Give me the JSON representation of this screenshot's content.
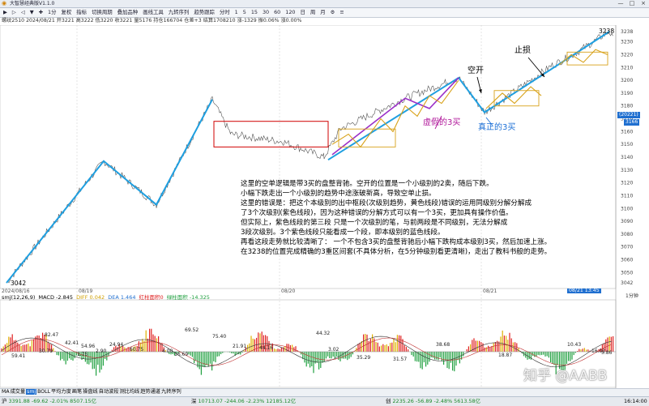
{
  "window": {
    "app_title": "大智慧经典版V1.1.0",
    "minimize": "—",
    "maximize": "□",
    "close": "×"
  },
  "toolbar": {
    "items": [
      "▶",
      "▷",
      "◁",
      "▼",
      "✚",
      "1分",
      "复权",
      "指标",
      "切换周期",
      "叠加品种",
      "画线工具",
      "九转序列",
      "趋势跟踪",
      "分时",
      "1",
      "5",
      "15",
      "30",
      "60",
      "120",
      "日",
      "周",
      "月",
      "⚙",
      "≡"
    ]
  },
  "infobar": {
    "text": "螺纹2510 2024/08/21 开3221 高3222 低3220 收3221 量5176 持仓166704 仓差+3 结算1708210 涨-1329 振0.06% 涨0.00%"
  },
  "price_axis": {
    "labels": [
      "3238",
      "3230",
      "3220",
      "3210",
      "3200",
      "3190",
      "3180",
      "3170",
      "3160",
      "3150",
      "3140",
      "3130",
      "3120",
      "3110",
      "3100",
      "3090",
      "3080",
      "3070",
      "3060",
      "3050",
      "3042"
    ],
    "current_price": "(20221)",
    "current_value": "3166",
    "high_label": "3238",
    "low_label": "3042"
  },
  "date_axis": {
    "labels": [
      "2024/08/16",
      "08/19",
      "08/20",
      "08/21"
    ],
    "time_marker": "08/21 13:45"
  },
  "chart_data": [
    {
      "type": "line",
      "title": "",
      "x": [
        "08/16 09:00",
        "08/16 21:00",
        "08/19 09:00",
        "08/19 21:00",
        "08/20 09:00",
        "08/20 21:00",
        "08/21 09:00",
        "08/21 13:45"
      ],
      "ylim": [
        3042,
        3238
      ],
      "annotations": [
        {
          "text": "空开",
          "color": "#000000"
        },
        {
          "text": "止损",
          "color": "#000000"
        },
        {
          "text": "虚假的3买",
          "color": "#b0179a"
        },
        {
          "text": "真正的3买",
          "color": "#1b6fd6"
        }
      ],
      "colors": {
        "price": "#555555",
        "trend": "#1f9fe0",
        "wrong_segment": "#9b30c8",
        "yellow_segment": "#d8a21a",
        "hub_box": "#d00000"
      }
    },
    {
      "type": "bar",
      "title": "smj(12,26,9)",
      "series": [
        {
          "name": "MACD",
          "values": [
            -2.845
          ]
        },
        {
          "name": "DIFF",
          "values": [
            0.042
          ]
        },
        {
          "name": "DEA",
          "values": [
            1.464
          ]
        }
      ],
      "legend_text": [
        "MACD -2.845",
        "DIFF 0.042",
        "DEA 1.464",
        "红柱面积0",
        "绿柱面积 -14.325"
      ],
      "value_labels": [
        "59.41",
        "82.47",
        "54.96",
        "69.52",
        "75.40",
        "21.91",
        "44.32",
        "38.68",
        "31.57",
        "18.87",
        "16.02",
        "60.75",
        "30.79",
        "42.41",
        "24.94",
        "44.16",
        "5.86",
        "1.75",
        "2.90",
        "4.00",
        "3.02",
        "16.69",
        "35.29",
        "10.43"
      ],
      "colors": {
        "red": "#e02020",
        "green": "#20a040",
        "yellow": "#e0b000"
      }
    }
  ],
  "annotation_text": [
    "这里的空单逻辑是带3买的盘整背驰。空开的位置是一个小级别的2卖，随后下跌。",
    "小幅下跌走出一个小级别的趋势中途涨破新高，导致空单止损。",
    "这里的错误是：把这个本级别的出中枢段(次级别趋势，黄色线段)错误的运用同级别分解分解成",
    "了3个次级别(紫色线段)，因为这种错误的分解方式可以有一个3买，更加具有操作价值。",
    "但实际上，紫色线段的第三段 只是一个次级别的笔，与前两段是不同级别，无法分解成",
    "3段次级别。3个紫色线段只能看成一个段，即本级别的蓝色线段。",
    "再看这段走势就比较清晰了： 一个不包含3买的盘整背驰后小幅下跌构成本级别3买，然后加速上涨。",
    "在3238的位置完成精确的3重区间套(不具体分析，在5分钟级别看更清晰)，走出了教科书般的走势。"
  ],
  "indicator_tabs": [
    "MA",
    "成交量",
    "smj",
    "BOLL",
    "平均力度",
    "画笔",
    "操盘线",
    "自动波段",
    "测比均线",
    "趋势通道",
    "九转序列"
  ],
  "watermark": "知乎 @AABB",
  "statusbar": {
    "items": [
      {
        "label": "沪",
        "value": "3391.88 -69.62 -2.01% 8507.15亿"
      },
      {
        "label": "深",
        "value": "10713.07 -244.06 -2.23% 12185.12亿"
      },
      {
        "label": "创",
        "value": "2235.26 -56.89 -2.48% 5613.58亿"
      }
    ],
    "time": "16:14:00"
  }
}
